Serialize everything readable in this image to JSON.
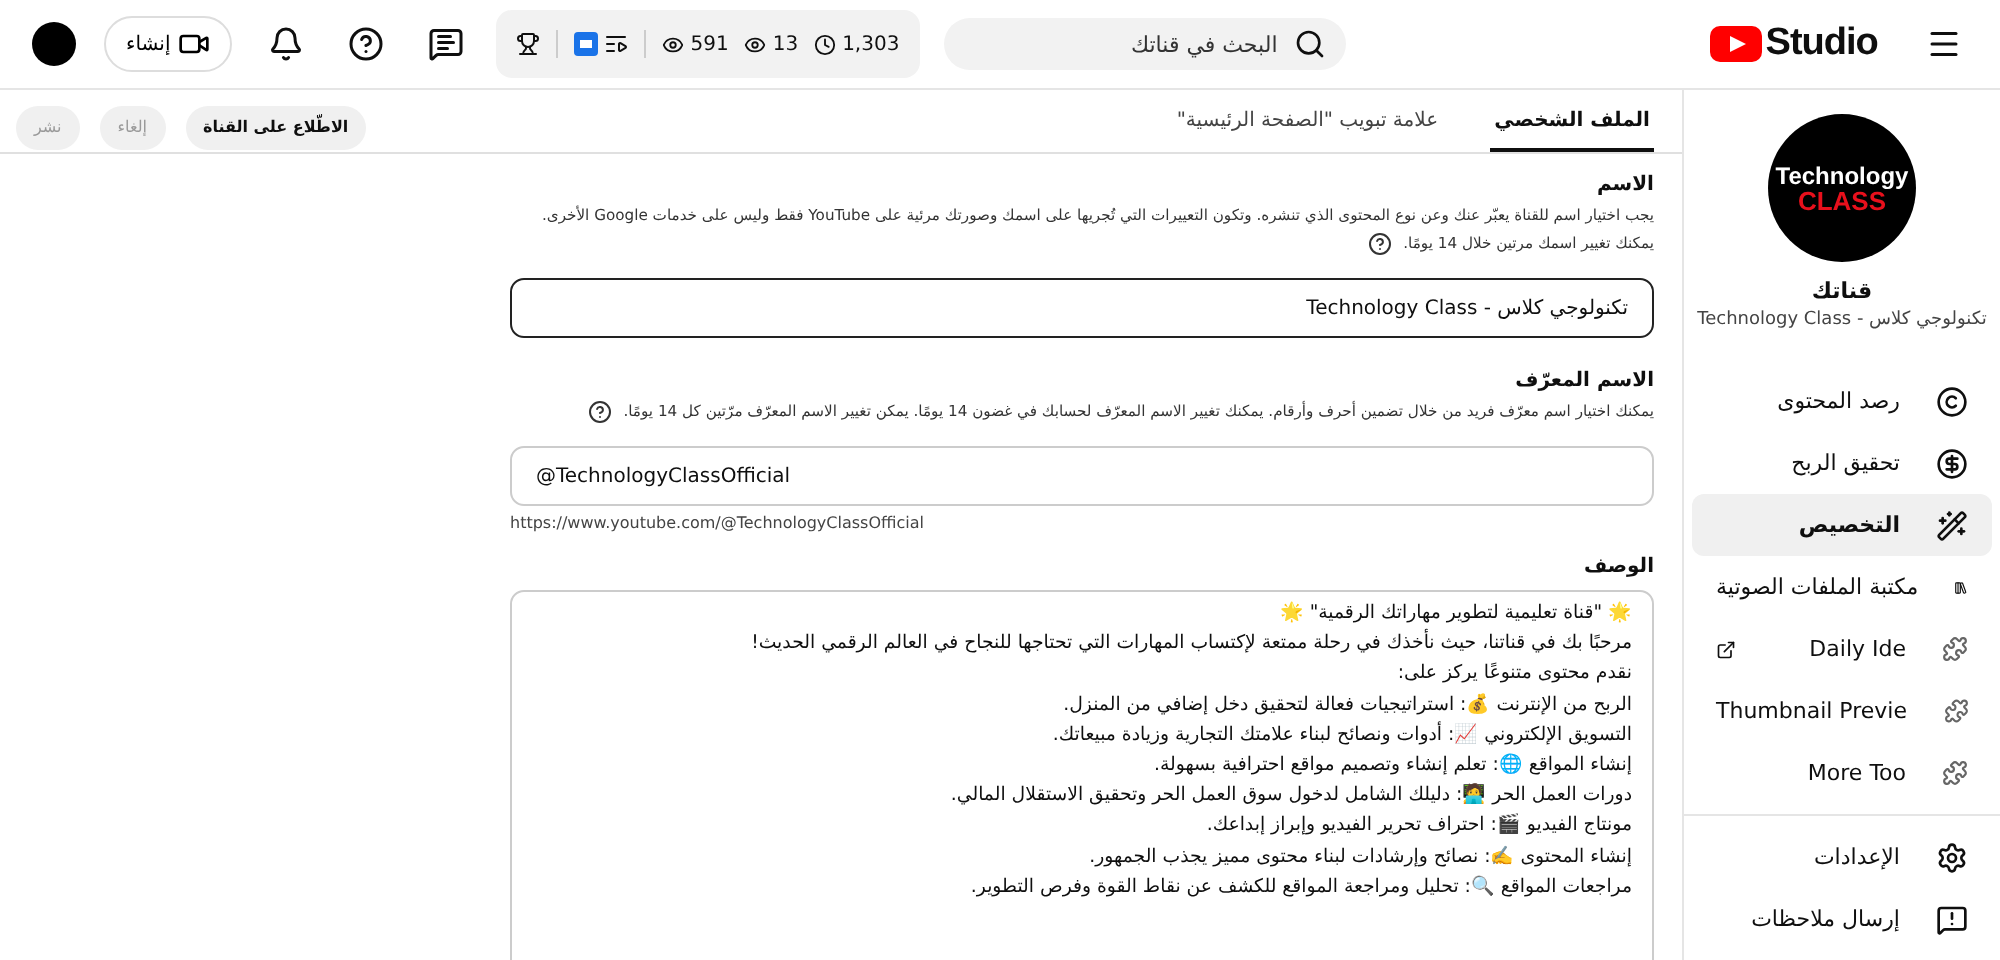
{
  "topbar": {
    "logo_text": "Studio",
    "search": {
      "placeholder": "البحث في قناتك"
    },
    "stats": [
      {
        "kind": "clock",
        "value": "1,303"
      },
      {
        "kind": "eye",
        "value": "13"
      },
      {
        "kind": "eye",
        "value": "591"
      }
    ],
    "create_button": "إنشاء"
  },
  "sidebar": {
    "channel_logo": {
      "line1": "Technology",
      "line2": "CLASS"
    },
    "title": "قناتك",
    "channel_name": "تكنولوجي كلاس - Technology Class",
    "items": [
      {
        "kind": "copyright",
        "label": "رصد المحتوى",
        "selected": false
      },
      {
        "kind": "dollar",
        "label": "تحقيق الربح",
        "selected": false
      },
      {
        "kind": "wand",
        "label": "التخصيص",
        "selected": true
      },
      {
        "kind": "music",
        "label": "مكتبة الملفات الصوتية",
        "selected": false
      },
      {
        "kind": "extension",
        "label": "Daily Ide",
        "selected": false,
        "external": true
      },
      {
        "kind": "extension",
        "label": "Thumbnail Previe",
        "selected": false,
        "external": false
      },
      {
        "kind": "extension",
        "label": "More Too",
        "selected": false,
        "external": false
      }
    ],
    "footer_items": [
      {
        "kind": "gear",
        "label": "الإعدادات"
      },
      {
        "kind": "feedback",
        "label": "إرسال ملاحظات"
      }
    ]
  },
  "tabs": [
    {
      "label": "الملف الشخصي",
      "selected": true
    },
    {
      "label": "علامة تبويب \"الصفحة الرئيسية\"",
      "selected": false
    }
  ],
  "actions": [
    {
      "label": "الاطّلاع على القناة",
      "disabled": false
    },
    {
      "label": "إلغاء",
      "disabled": true
    },
    {
      "label": "نشر",
      "disabled": true
    }
  ],
  "name_section": {
    "title": "الاسم",
    "help": "يجب اختيار اسم للقناة يعبّر عنك وعن نوع المحتوى الذي تنشره. وتكون التعييرات التي تُجريها على اسمك وصورتك مرئية على YouTube فقط وليس على خدمات Google الأخرى. يمكنك تغيير اسمك مرتين خلال 14 يومًا.",
    "value": "تكنولوجي كلاس - Technology Class"
  },
  "handle_section": {
    "title": "الاسم المعرّف",
    "help": "يمكنك اختيار اسم معرّف فريد من خلال تضمين أحرف وأرقام. يمكنك تغيير الاسم المعرّف لحسابك في غضون 14 يومًا. يمكن تغيير الاسم المعرّف مرّتين كل 14 يومًا.",
    "value": "@TechnologyClassOfficial",
    "url": "https://www.youtube.com/@TechnologyClassOfficial"
  },
  "description_section": {
    "title": "الوصف",
    "lines": [
      "🌟 \"قناة تعليمية لتطوير مهاراتك الرقمية\" 🌟",
      "مرحبًا بك في قناتنا، حيث نأخذك في رحلة ممتعة لإكتساب المهارات التي تحتاجها للنجاح في العالم الرقمي الحديث!",
      "نقدم محتوى متنوعًا يركز على:",
      "الربح من الإنترنت 💰: استراتيجيات فعالة لتحقيق دخل إضافي من المنزل.",
      "التسويق الإلكتروني 📈: أدوات ونصائح لبناء علامتك التجارية وزيادة مبيعاتك.",
      "إنشاء المواقع 🌐: تعلم إنشاء وتصميم مواقع احترافية بسهولة.",
      "دورات العمل الحر 🧑‍💻: دليلك الشامل لدخول سوق العمل الحر وتحقيق الاستقلال المالي.",
      "مونتاج الفيديو 🎬: احتراف تحرير الفيديو وإبراز إبداعك.",
      "إنشاء المحتوى ✍️: نصائح وإرشادات لبناء محتوى مميز يجذب الجمهور.",
      "مراجعات المواقع 🔍: تحليل ومراجعة المواقع للكشف عن نقاط القوة وفرص التطوير."
    ]
  }
}
